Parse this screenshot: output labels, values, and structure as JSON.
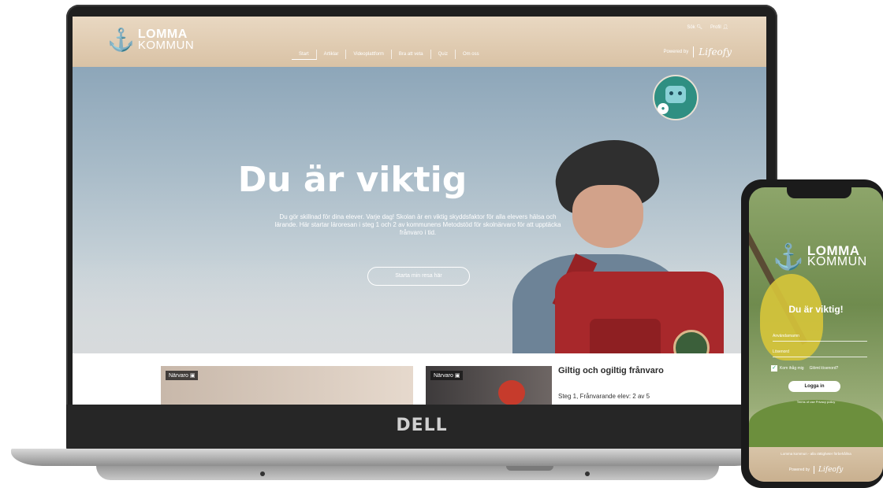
{
  "site": {
    "logo_line1": "LOMMA",
    "logo_line2": "KOMMUN",
    "utility": {
      "search": "Sök",
      "profile": "Profil"
    },
    "nav": [
      "Start",
      "Artiklar",
      "Videoplattform",
      "Bra att veta",
      "Quiz",
      "Om oss"
    ],
    "powered_by_label": "Powered by",
    "brand": "Lifeofy"
  },
  "hero": {
    "title": "Du är viktig",
    "description": "Du gör skillnad för dina elever. Varje dag! Skolan är en viktig skyddsfaktor för alla elevers hälsa och lärande. Här startar läroresan i steg 1 och 2 av kommunens Metodstöd för skolnärvaro för att upptäcka frånvaro i tid.",
    "cta": "Starta min resa här"
  },
  "cards": {
    "card1_tag": "Närvaro",
    "card2_tag": "Närvaro",
    "card2_title": "Giltig och ogiltig frånvaro",
    "card2_sub": "Steg 1, Frånvarande elev: 2 av 5"
  },
  "laptop": {
    "brand": "DELL"
  },
  "phone": {
    "logo_line1": "LOMMA",
    "logo_line2": "KOMMUN",
    "title": "Du är viktig!",
    "username_label": "Användarnamn",
    "password_label": "Lösenord",
    "remember": "Kom ihåg mig",
    "forgot": "Glömt lösenord?",
    "login": "Logga in",
    "terms": "Terms of use   Privacy policy",
    "footer": "Lomma kommun - alla rättigheter förbehållna",
    "powered_by_label": "Powered by",
    "brand": "Lifeofy"
  }
}
